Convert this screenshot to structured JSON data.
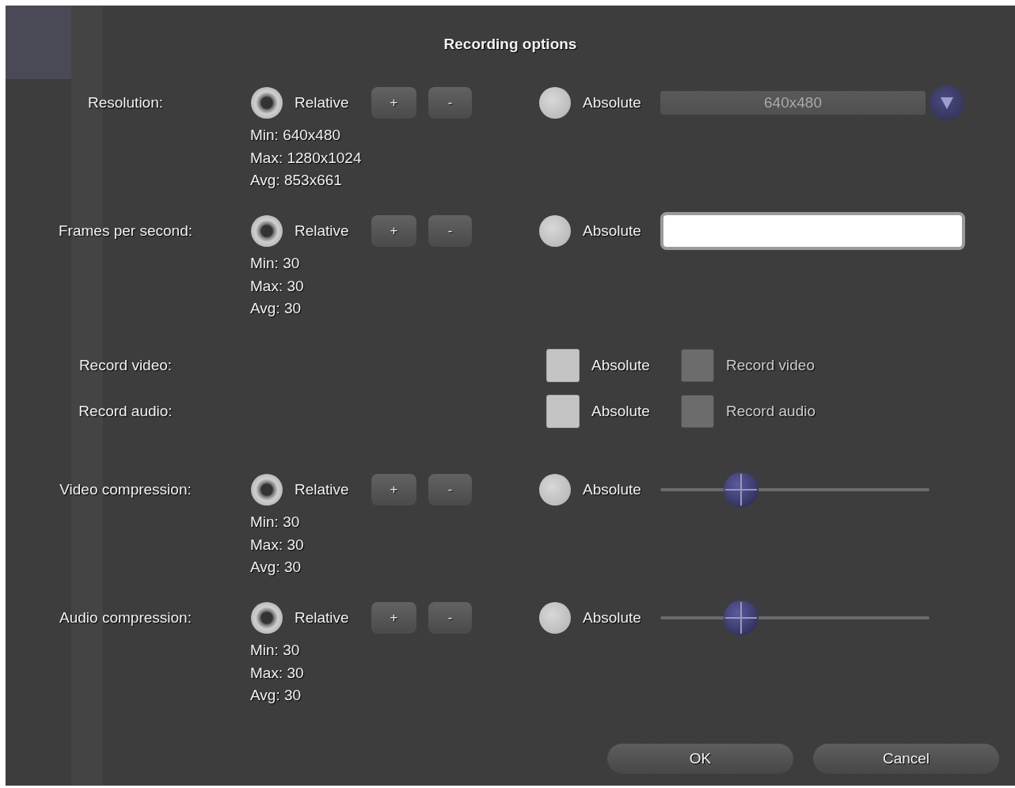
{
  "dialog": {
    "title": "Recording options",
    "rows": [
      {
        "kind": "range",
        "label": "Resolution:",
        "options": [
          {
            "label": "Relative",
            "selected": true
          },
          {
            "label": "Absolute",
            "selected": false
          }
        ],
        "buttons": [
          "+",
          "-"
        ],
        "stats": [
          "Min: 640x480",
          "Max: 1280x1024",
          "Avg: 853x661"
        ],
        "control": {
          "kind": "dropdown",
          "value": "640x480"
        }
      },
      {
        "kind": "range",
        "label": "Frames per second:",
        "options": [
          {
            "label": "Relative",
            "selected": true
          },
          {
            "label": "Absolute",
            "selected": false
          }
        ],
        "buttons": [
          "+",
          "-"
        ],
        "stats": [
          "Min: 30",
          "Max: 30",
          "Avg: 30"
        ],
        "control": {
          "kind": "text_field"
        }
      },
      {
        "kind": "toggle",
        "label": "Record video:",
        "checkboxes": [
          {
            "label": "Absolute",
            "checked": false,
            "disabled": false
          },
          {
            "label": "Record video",
            "checked": false,
            "disabled": true
          }
        ]
      },
      {
        "kind": "toggle",
        "label": "Record audio:",
        "checkboxes": [
          {
            "label": "Absolute",
            "checked": false,
            "disabled": false
          },
          {
            "label": "Record audio",
            "checked": false,
            "disabled": true
          }
        ]
      },
      {
        "kind": "range",
        "label": "Video compression:",
        "options": [
          {
            "label": "Relative",
            "selected": true
          },
          {
            "label": "Absolute",
            "selected": false
          }
        ],
        "buttons": [
          "+",
          "-"
        ],
        "stats": [
          "Min: 30",
          "Max: 30",
          "Avg: 30"
        ],
        "control": {
          "kind": "slider",
          "level": 0.3
        }
      },
      {
        "kind": "range",
        "label": "Audio compression:",
        "options": [
          {
            "label": "Relative",
            "selected": true
          },
          {
            "label": "Absolute",
            "selected": false
          }
        ],
        "buttons": [
          "+",
          "-"
        ],
        "stats": [
          "Min: 30",
          "Max: 30",
          "Avg: 30"
        ],
        "control": {
          "kind": "slider",
          "level": 0.3
        }
      }
    ],
    "buttons": [
      "OK",
      "Cancel"
    ]
  }
}
